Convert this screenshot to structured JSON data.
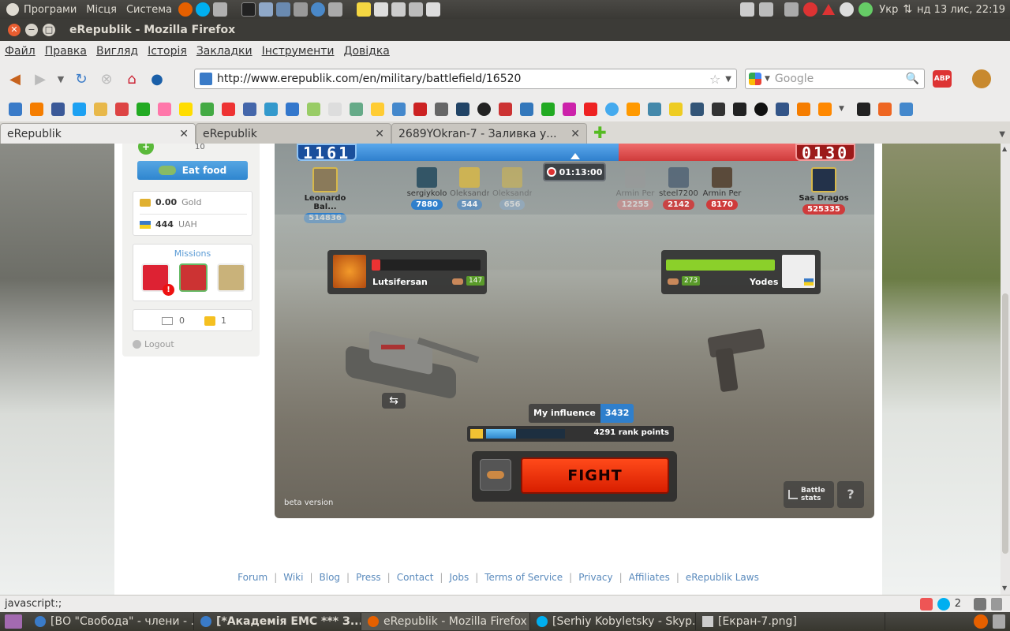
{
  "topbar": {
    "menus": [
      "Програми",
      "Місця",
      "Система"
    ],
    "keyboard": "Укр",
    "datetime": "нд 13 лис, 22:19"
  },
  "window": {
    "title": "eRepublik - Mozilla Firefox"
  },
  "menubar": [
    "Файл",
    "Правка",
    "Вигляд",
    "Історія",
    "Закладки",
    "Інструменти",
    "Довідка"
  ],
  "nav": {
    "url": "http://www.erepublik.com/en/military/battlefield/16520",
    "search_placeholder": "Google"
  },
  "tabs": [
    {
      "label": "eRepublik"
    },
    {
      "label": "eRepublik"
    },
    {
      "label": "2689YOkran-7 - Заливка у..."
    }
  ],
  "sidebar": {
    "level_value": "10",
    "eat_food": "Eat food",
    "gold_value": "0.00",
    "gold_label": "Gold",
    "uah_value": "444",
    "uah_label": "UAH",
    "missions": "Missions",
    "messages": "0",
    "alerts": "1",
    "logout": "Logout"
  },
  "battle": {
    "left_score": "1161",
    "right_score": "0130",
    "timer": "01:13:00",
    "left_hero": {
      "name": "Leonardo Bal...",
      "value": "514836"
    },
    "right_hero": {
      "name": "Sas Dragos",
      "value": "525335"
    },
    "left_fighters": [
      {
        "name": "sergiykolo",
        "value": "7880"
      },
      {
        "name": "Oleksandr",
        "value": "544"
      },
      {
        "name": "Oleksandr",
        "value": "656"
      }
    ],
    "right_fighters": [
      {
        "name": "Armin Per",
        "value": "12255"
      },
      {
        "name": "steel7200",
        "value": "2142"
      },
      {
        "name": "Armin Per",
        "value": "8170"
      }
    ],
    "player": {
      "name": "Lutsifersan",
      "skill": "147",
      "health": 0.08
    },
    "enemy": {
      "name": "Yodes",
      "skill": "273",
      "health": 1.0
    },
    "influence_label": "My influence",
    "influence_value": "3432",
    "rank_points": "4291 rank points",
    "rank_progress": 0.38,
    "fight": "FIGHT",
    "battle_stats": "Battle stats",
    "beta": "beta version"
  },
  "footer": {
    "links": [
      "Forum",
      "Wiki",
      "Blog",
      "Press",
      "Contact",
      "Jobs",
      "Terms of Service",
      "Privacy",
      "Affiliates",
      "eRepublik Laws"
    ]
  },
  "status": {
    "text": "javascript:;",
    "skype_count": "2"
  },
  "taskbar": [
    {
      "label": "[ВО \"Свобода\" - члени - ..."
    },
    {
      "label": "[*Академія ЕМС *** З..."
    },
    {
      "label": "eRepublik - Mozilla Firefox"
    },
    {
      "label": "[Serhiy Kobyletsky - Skyp..."
    },
    {
      "label": "[Екран-7.png]"
    }
  ]
}
